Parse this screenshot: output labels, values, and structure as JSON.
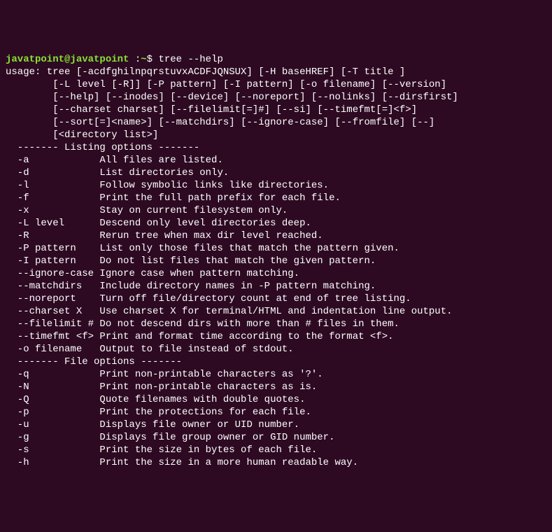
{
  "prompt": {
    "user_host": "javatpoint@javatpoint",
    "separator": " :",
    "tilde": "~",
    "symbol": "$ ",
    "command": "tree --help"
  },
  "usage": [
    "usage: tree [-acdfghilnpqrstuvxACDFJQNSUX] [-H baseHREF] [-T title ]",
    "\t[-L level [-R]] [-P pattern] [-I pattern] [-o filename] [--version]",
    "\t[--help] [--inodes] [--device] [--noreport] [--nolinks] [--dirsfirst]",
    "\t[--charset charset] [--filelimit[=]#] [--si] [--timefmt[=]<f>]",
    "\t[--sort[=]<name>] [--matchdirs] [--ignore-case] [--fromfile] [--]",
    "\t[<directory list>]"
  ],
  "sections": [
    {
      "header": "  ------- Listing options -------",
      "options": [
        {
          "flag": "  -a          ",
          "desc": "  All files are listed."
        },
        {
          "flag": "  -d          ",
          "desc": "  List directories only."
        },
        {
          "flag": "  -l          ",
          "desc": "  Follow symbolic links like directories."
        },
        {
          "flag": "  -f          ",
          "desc": "  Print the full path prefix for each file."
        },
        {
          "flag": "  -x          ",
          "desc": "  Stay on current filesystem only."
        },
        {
          "flag": "  -L level    ",
          "desc": "  Descend only level directories deep."
        },
        {
          "flag": "  -R          ",
          "desc": "  Rerun tree when max dir level reached."
        },
        {
          "flag": "  -P pattern  ",
          "desc": "  List only those files that match the pattern given."
        },
        {
          "flag": "  -I pattern  ",
          "desc": "  Do not list files that match the given pattern."
        },
        {
          "flag": "  --ignore-case",
          "desc": " Ignore case when pattern matching."
        },
        {
          "flag": "  --matchdirs ",
          "desc": "  Include directory names in -P pattern matching."
        },
        {
          "flag": "  --noreport  ",
          "desc": "  Turn off file/directory count at end of tree listing."
        },
        {
          "flag": "  --charset X ",
          "desc": "  Use charset X for terminal/HTML and indentation line output."
        },
        {
          "flag": "  --filelimit #",
          "desc": " Do not descend dirs with more than # files in them."
        },
        {
          "flag": "  --timefmt <f>",
          "desc": " Print and format time according to the format <f>."
        },
        {
          "flag": "  -o filename ",
          "desc": "  Output to file instead of stdout."
        }
      ]
    },
    {
      "header": "  ------- File options -------",
      "options": [
        {
          "flag": "  -q          ",
          "desc": "  Print non-printable characters as '?'."
        },
        {
          "flag": "  -N          ",
          "desc": "  Print non-printable characters as is."
        },
        {
          "flag": "  -Q          ",
          "desc": "  Quote filenames with double quotes."
        },
        {
          "flag": "  -p          ",
          "desc": "  Print the protections for each file."
        },
        {
          "flag": "  -u          ",
          "desc": "  Displays file owner or UID number."
        },
        {
          "flag": "  -g          ",
          "desc": "  Displays file group owner or GID number."
        },
        {
          "flag": "  -s          ",
          "desc": "  Print the size in bytes of each file."
        },
        {
          "flag": "  -h          ",
          "desc": "  Print the size in a more human readable way."
        }
      ]
    }
  ]
}
